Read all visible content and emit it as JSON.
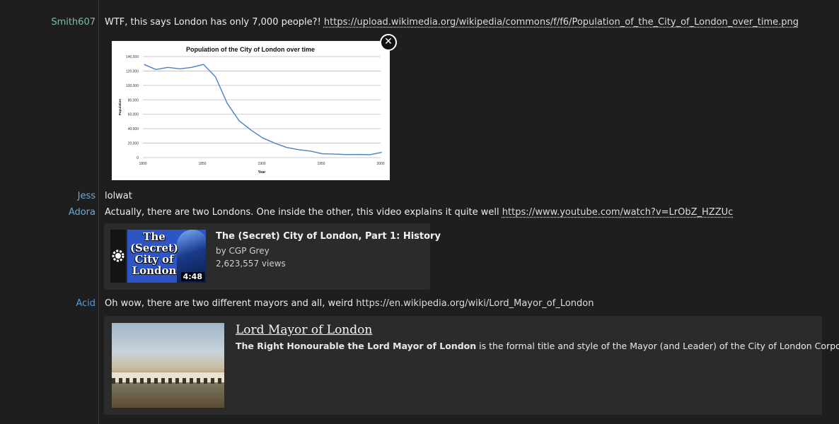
{
  "messages": [
    {
      "nick": "Smith607",
      "nick_color": "#7fbf9a",
      "text": "WTF, this says London has only 7,000 people?!",
      "link": "https://upload.wikimedia.org/wikipedia/commons/f/f6/Population_of_the_City_of_London_over_time.png"
    },
    {
      "nick": "Jess",
      "nick_color": "#6aa9d6",
      "text": "lolwat"
    },
    {
      "nick": "Adora",
      "nick_color": "#6aa9d6",
      "text": "Actually, there are two Londons. One inside the other, this video explains it quite well",
      "link": "https://www.youtube.com/watch?v=LrObZ_HZZUc"
    },
    {
      "nick": "Acid",
      "nick_color": "#4f9fe0",
      "text": "Oh wow, there are two different mayors and all, weird",
      "link": "https://en.wikipedia.org/wiki/Lord_Mayor_of_London"
    }
  ],
  "image_embed": {
    "close_label": "✕"
  },
  "chart_data": {
    "type": "line",
    "title": "Population of the City of London over time",
    "xlabel": "Year",
    "ylabel": "Population",
    "xlim": [
      1800,
      2000
    ],
    "ylim": [
      0,
      140000
    ],
    "xticks": [
      1800,
      1850,
      1900,
      1950,
      2000
    ],
    "yticks": [
      0,
      20000,
      40000,
      60000,
      80000,
      100000,
      120000,
      140000
    ],
    "ytick_labels": [
      "0",
      "20,000",
      "40,000",
      "60,000",
      "80,000",
      "100,000",
      "120,000",
      "140,000"
    ],
    "x": [
      1801,
      1811,
      1821,
      1831,
      1841,
      1851,
      1861,
      1871,
      1881,
      1891,
      1901,
      1911,
      1921,
      1931,
      1941,
      1951,
      1961,
      1971,
      1981,
      1991,
      2001
    ],
    "values": [
      129000,
      122000,
      125000,
      123000,
      125000,
      129000,
      112000,
      75000,
      51000,
      38000,
      27000,
      20000,
      14000,
      11000,
      9000,
      5300,
      4800,
      4200,
      4300,
      4000,
      7200
    ],
    "line_color": "#4a7fc1",
    "grid": true
  },
  "youtube": {
    "title": "The (Secret) City of London, Part 1: History",
    "channel": "by CGP Grey",
    "views": "2,623,557 views",
    "thumb_text": "The\n(Secret)\nCity of\nLondon",
    "duration": "4:48"
  },
  "wiki": {
    "title": "Lord Mayor of London",
    "bold": "The Right Honourable the Lord Mayor of London",
    "rest": " is the formal title and style of the Mayor (and Leader) of the City of London Corporation."
  }
}
